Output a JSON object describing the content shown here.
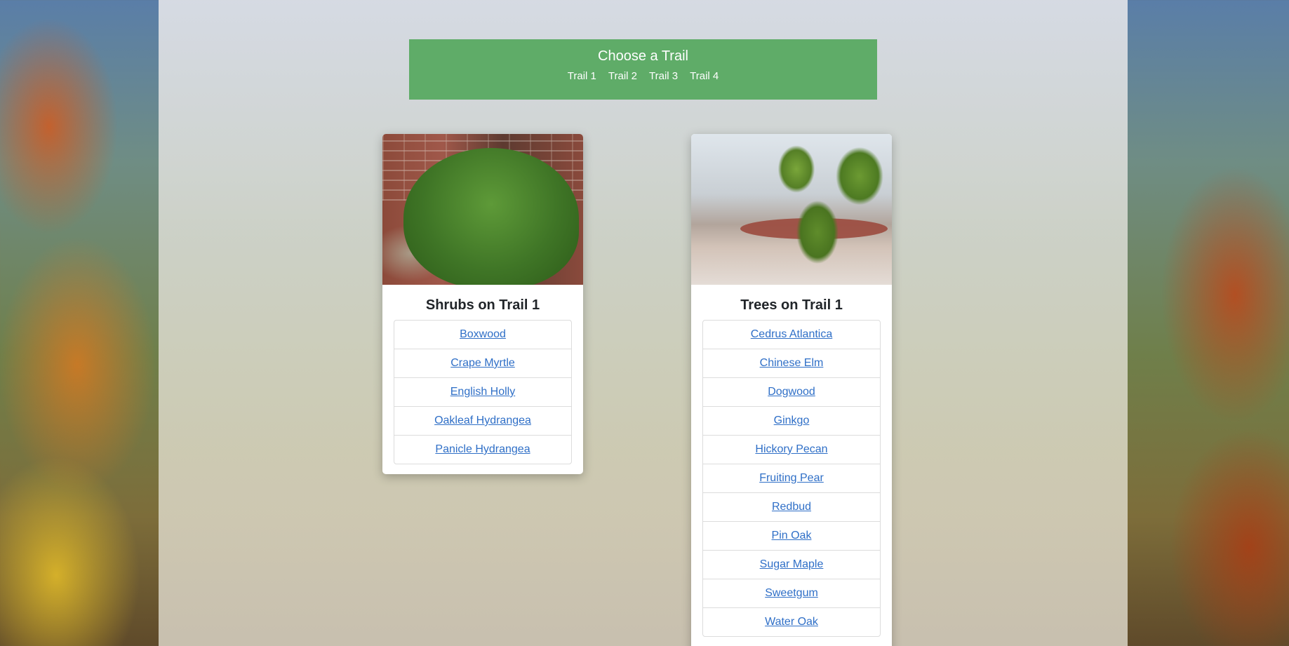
{
  "menu": {
    "title": "Choose a Trail",
    "trails": [
      "Trail 1",
      "Trail 2",
      "Trail 3",
      "Trail 4"
    ]
  },
  "shrubs_card": {
    "title": "Shrubs on Trail 1",
    "items": [
      "Boxwood",
      "Crape Myrtle",
      "English Holly",
      "Oakleaf Hydrangea",
      "Panicle Hydrangea"
    ]
  },
  "trees_card": {
    "title": "Trees on Trail 1",
    "items": [
      "Cedrus Atlantica",
      "Chinese Elm",
      "Dogwood",
      "Ginkgo",
      "Hickory Pecan",
      "Fruiting Pear",
      "Redbud",
      "Pin Oak",
      "Sugar Maple",
      "Sweetgum",
      "Water Oak"
    ]
  },
  "colors": {
    "menu_background": "#5fac68",
    "link": "#2f6fc7"
  }
}
